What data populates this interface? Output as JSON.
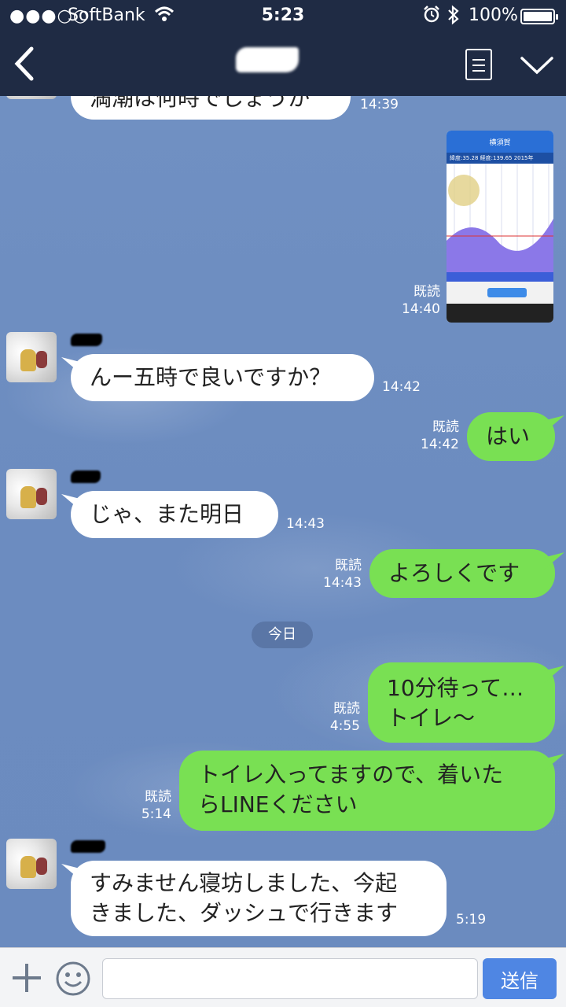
{
  "status_bar": {
    "signal": "●●●○○",
    "carrier": "SoftBank",
    "time": "5:23",
    "battery": "100%"
  },
  "header": {
    "title": ""
  },
  "messages": [
    {
      "side": "in",
      "text": "満潮は何時でしょうか",
      "time": "14:39"
    },
    {
      "side": "out",
      "kind": "image",
      "read": "既読",
      "time": "14:40"
    },
    {
      "side": "in",
      "text": "んー五時で良いですか？",
      "time": "14:42"
    },
    {
      "side": "out",
      "text": "はい",
      "read": "既読",
      "time": "14:42"
    },
    {
      "side": "in",
      "text": "じゃ、また明日",
      "time": "14:43"
    },
    {
      "side": "out",
      "text": "よろしくです",
      "read": "既読",
      "time": "14:43"
    },
    {
      "side": "out",
      "text": "10分待って…",
      "text2": "トイレ〜",
      "read": "既読",
      "time": "4:55"
    },
    {
      "side": "out",
      "text": "トイレ入ってますので、着いた",
      "text2": "らLINEください",
      "read": "既読",
      "time": "5:14"
    },
    {
      "side": "in",
      "text": "すみません寝坊しました、今起",
      "text2": "きました、ダッシュで行きます",
      "time": "5:19"
    }
  ],
  "date_divider": "今日",
  "thumbnail": {
    "title": "横須賀",
    "info": "緯度:35.28 経度:139.65 2015年"
  },
  "input": {
    "placeholder": "",
    "send_label": "送信"
  },
  "colors": {
    "header_bg": "#1f2b44",
    "chat_bg": "#6f8fc0",
    "outgoing_bubble": "#79e053",
    "incoming_bubble": "#ffffff",
    "send_button": "#4f86e3"
  }
}
